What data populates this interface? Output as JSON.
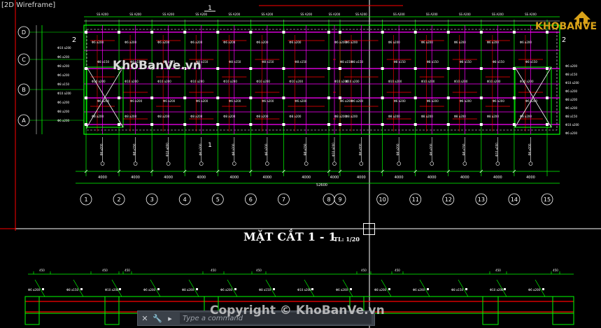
{
  "viewport": {
    "label": "[2D Wireframe]"
  },
  "section_title": {
    "text": "MẶT CẮT 1 - 1",
    "scale": "TL: 1/20"
  },
  "watermark": {
    "mid": "KhoBanVe.vn",
    "copyright": "Copyright © KhoBanVe.vn"
  },
  "logo": {
    "text": "KHOBANVE"
  },
  "command_line": {
    "placeholder": "Type a command"
  },
  "grid_axes": {
    "columns": [
      "1",
      "2",
      "3",
      "4",
      "5",
      "6",
      "7",
      "8",
      "9",
      "10",
      "11",
      "12",
      "13",
      "14",
      "15"
    ],
    "rows": [
      "D",
      "C",
      "B",
      "A"
    ],
    "section_marks": [
      "1",
      "1"
    ],
    "detail_marks": [
      "2",
      "2"
    ]
  },
  "dimensions": {
    "spans": [
      "4000",
      "4000",
      "4000",
      "4000",
      "4000",
      "4000",
      "4000",
      "4000",
      "4000",
      "4000",
      "4000",
      "4000",
      "4000",
      "4000"
    ],
    "total": "52600"
  },
  "rebar_notes": [
    "Φ6 a200",
    "Φ8 a150",
    "Φ10 a200",
    "Φ6 a200",
    "Φ8 a200"
  ],
  "colors": {
    "background": "#000000",
    "grid_line": "#00ff00",
    "beam": "#ff00ff",
    "rebar": "#ff0000",
    "text": "#ffffff",
    "logo": "#d9a218"
  }
}
